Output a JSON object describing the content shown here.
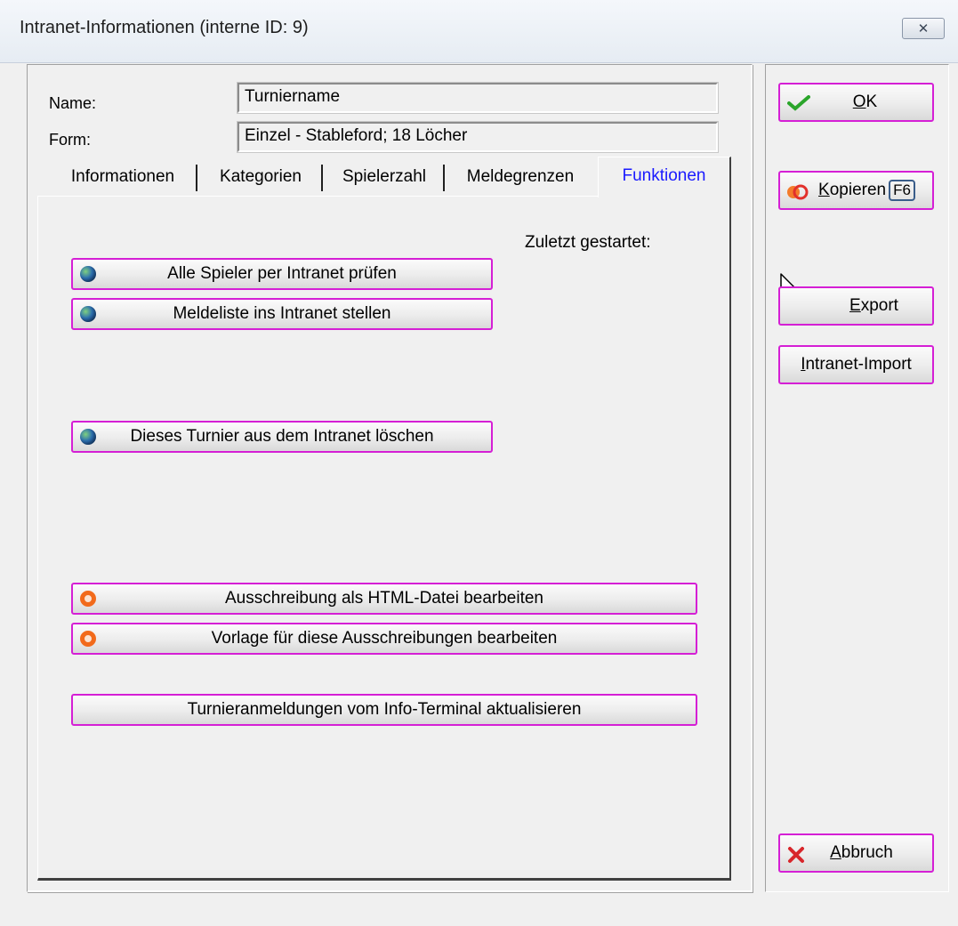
{
  "window": {
    "title": "Intranet-Informationen (interne ID: 9)",
    "close_glyph": "✕"
  },
  "form": {
    "name_label": "Name:",
    "name_value": "Turniername",
    "form_label": "Form:",
    "form_value": "Einzel - Stableford; 18 Löcher"
  },
  "tabs": [
    {
      "label": "Informationen"
    },
    {
      "label": "Kategorien"
    },
    {
      "label": "Spielerzahl"
    },
    {
      "label": "Meldegrenzen"
    },
    {
      "label": "Funktionen",
      "active": true
    }
  ],
  "panel": {
    "last_started_label": "Zuletzt gestartet:",
    "buttons": [
      {
        "label": "Alle Spieler per Intranet prüfen",
        "icon": "globe-icon"
      },
      {
        "label": "Meldeliste ins Intranet stellen",
        "icon": "globe-icon"
      },
      {
        "label": "Dieses Turnier aus dem Intranet löschen",
        "icon": "globe-icon"
      },
      {
        "label": "Ausschreibung als HTML-Datei bearbeiten",
        "icon": "ring-icon"
      },
      {
        "label": "Vorlage für diese Ausschreibungen bearbeiten",
        "icon": "ring-icon"
      },
      {
        "label": "Turnieranmeldungen vom Info-Terminal aktualisieren",
        "icon": ""
      }
    ]
  },
  "sidebar": {
    "ok": {
      "accel": "O",
      "rest": "K",
      "icon": "checkmark-icon"
    },
    "copy": {
      "accel": "K",
      "rest": "opieren",
      "shortcut": "F6",
      "icon": "copy-icon"
    },
    "export": {
      "accel": "E",
      "rest": "xport"
    },
    "intranet_import": {
      "accel": "I",
      "rest": "ntranet-Import"
    },
    "cancel": {
      "accel": "A",
      "rest": "bbruch",
      "icon": "cancel-icon"
    }
  },
  "colors": {
    "accent_border": "#d51fd5",
    "active_tab_text": "#1a1aff"
  }
}
